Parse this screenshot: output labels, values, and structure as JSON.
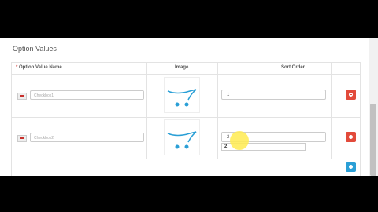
{
  "section_title": "Option Values",
  "table": {
    "headers": {
      "required_mark": "*",
      "name": "Option Value Name",
      "image": "Image",
      "sort_order": "Sort Order"
    },
    "rows": [
      {
        "name_placeholder": "Checkbox1",
        "sort_order": "1"
      },
      {
        "name_placeholder": "Checkbox2",
        "sort_order": "2"
      }
    ],
    "autocomplete_value": "2"
  },
  "colors": {
    "remove_button": "#e24a3b",
    "add_button": "#2a9fd6",
    "cart_icon": "#2a9fd6",
    "cursor_highlight": "#ffeb50"
  },
  "icons": {
    "language_flag": "language-flag-icon",
    "cart": "cart-placeholder-icon",
    "remove": "minus-circle-icon",
    "add": "plus-circle-icon"
  }
}
